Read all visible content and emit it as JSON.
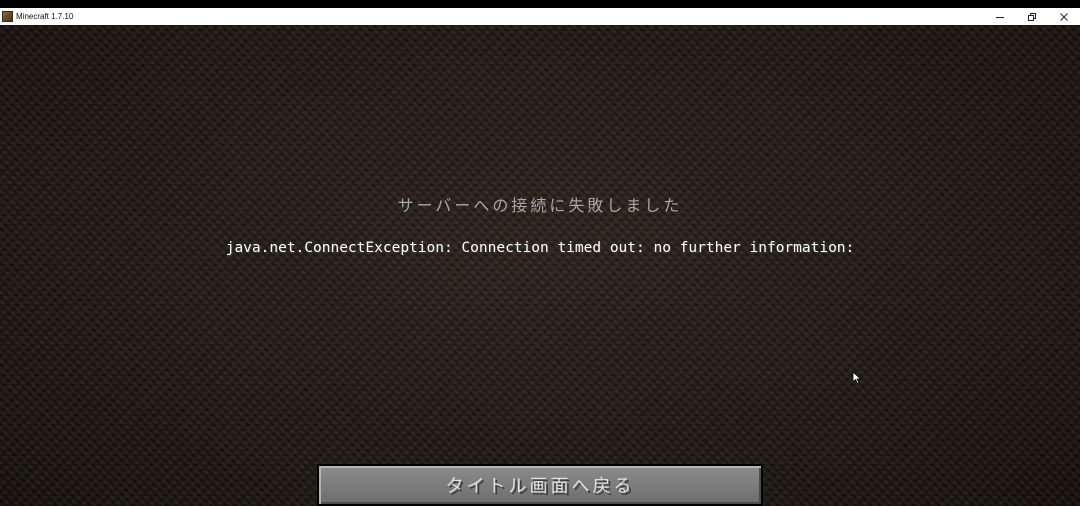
{
  "window": {
    "title": "Minecraft 1.7.10",
    "icon": "minecraft-block-icon",
    "controls": [
      "minimize-icon",
      "restore-icon",
      "close-icon"
    ]
  },
  "screen": {
    "error_title": "サーバーへの接続に失敗しました",
    "error_message": "java.net.ConnectException: Connection timed out: no further information:",
    "back_button_label": "タイトル画面へ戻る"
  }
}
